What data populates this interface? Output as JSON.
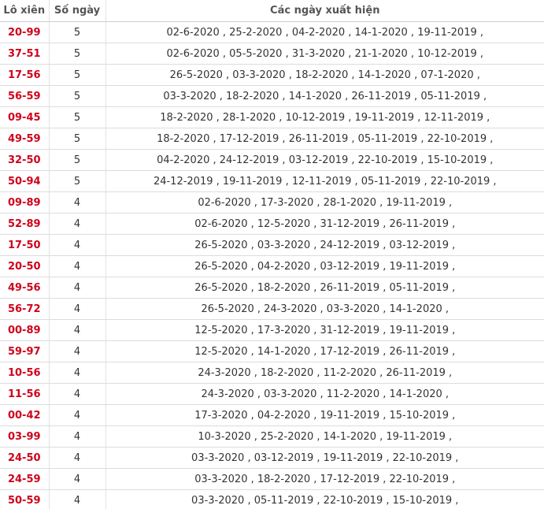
{
  "table": {
    "headers": [
      "Lô xiên",
      "Số ngày",
      "Các ngày xuất hiện"
    ],
    "rows": [
      {
        "pair": "20-99",
        "days": "5",
        "dates": "02-6-2020 , 25-2-2020 , 04-2-2020 , 14-1-2020 , 19-11-2019 ,"
      },
      {
        "pair": "37-51",
        "days": "5",
        "dates": "02-6-2020 , 05-5-2020 , 31-3-2020 , 21-1-2020 , 10-12-2019 ,"
      },
      {
        "pair": "17-56",
        "days": "5",
        "dates": "26-5-2020 , 03-3-2020 , 18-2-2020 , 14-1-2020 , 07-1-2020 ,"
      },
      {
        "pair": "56-59",
        "days": "5",
        "dates": "03-3-2020 , 18-2-2020 , 14-1-2020 , 26-11-2019 , 05-11-2019 ,"
      },
      {
        "pair": "09-45",
        "days": "5",
        "dates": "18-2-2020 , 28-1-2020 , 10-12-2019 , 19-11-2019 , 12-11-2019 ,"
      },
      {
        "pair": "49-59",
        "days": "5",
        "dates": "18-2-2020 , 17-12-2019 , 26-11-2019 , 05-11-2019 , 22-10-2019 ,"
      },
      {
        "pair": "32-50",
        "days": "5",
        "dates": "04-2-2020 , 24-12-2019 , 03-12-2019 , 22-10-2019 , 15-10-2019 ,"
      },
      {
        "pair": "50-94",
        "days": "5",
        "dates": "24-12-2019 , 19-11-2019 , 12-11-2019 , 05-11-2019 , 22-10-2019 ,"
      },
      {
        "pair": "09-89",
        "days": "4",
        "dates": "02-6-2020 , 17-3-2020 , 28-1-2020 , 19-11-2019 ,"
      },
      {
        "pair": "52-89",
        "days": "4",
        "dates": "02-6-2020 , 12-5-2020 , 31-12-2019 , 26-11-2019 ,"
      },
      {
        "pair": "17-50",
        "days": "4",
        "dates": "26-5-2020 , 03-3-2020 , 24-12-2019 , 03-12-2019 ,"
      },
      {
        "pair": "20-50",
        "days": "4",
        "dates": "26-5-2020 , 04-2-2020 , 03-12-2019 , 19-11-2019 ,"
      },
      {
        "pair": "49-56",
        "days": "4",
        "dates": "26-5-2020 , 18-2-2020 , 26-11-2019 , 05-11-2019 ,"
      },
      {
        "pair": "56-72",
        "days": "4",
        "dates": "26-5-2020 , 24-3-2020 , 03-3-2020 , 14-1-2020 ,"
      },
      {
        "pair": "00-89",
        "days": "4",
        "dates": "12-5-2020 , 17-3-2020 , 31-12-2019 , 19-11-2019 ,"
      },
      {
        "pair": "59-97",
        "days": "4",
        "dates": "12-5-2020 , 14-1-2020 , 17-12-2019 , 26-11-2019 ,"
      },
      {
        "pair": "10-56",
        "days": "4",
        "dates": "24-3-2020 , 18-2-2020 , 11-2-2020 , 26-11-2019 ,"
      },
      {
        "pair": "11-56",
        "days": "4",
        "dates": "24-3-2020 , 03-3-2020 , 11-2-2020 , 14-1-2020 ,"
      },
      {
        "pair": "00-42",
        "days": "4",
        "dates": "17-3-2020 , 04-2-2020 , 19-11-2019 , 15-10-2019 ,"
      },
      {
        "pair": "03-99",
        "days": "4",
        "dates": "10-3-2020 , 25-2-2020 , 14-1-2020 , 19-11-2019 ,"
      },
      {
        "pair": "24-50",
        "days": "4",
        "dates": "03-3-2020 , 03-12-2019 , 19-11-2019 , 22-10-2019 ,"
      },
      {
        "pair": "24-59",
        "days": "4",
        "dates": "03-3-2020 , 18-2-2020 , 17-12-2019 , 22-10-2019 ,"
      },
      {
        "pair": "50-59",
        "days": "4",
        "dates": "03-3-2020 , 05-11-2019 , 22-10-2019 , 15-10-2019 ,"
      }
    ]
  },
  "colors": {
    "pair_text": "#d0021b",
    "header_text": "#555555",
    "body_text": "#333333"
  }
}
